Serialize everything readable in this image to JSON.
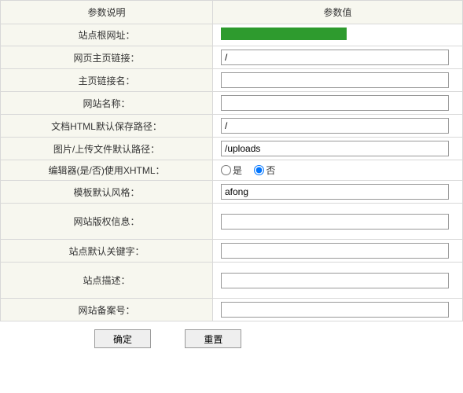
{
  "headers": {
    "param_desc": "参数说明",
    "param_value": "参数值"
  },
  "rows": {
    "root_url": {
      "label": "站点根网址：",
      "value": ""
    },
    "home_link": {
      "label": "网页主页链接：",
      "value": "/"
    },
    "home_link_name": {
      "label": "主页链接名：",
      "value": ""
    },
    "site_name": {
      "label": "网站名称：",
      "value": ""
    },
    "html_path": {
      "label": "文档HTML默认保存路径：",
      "value": "/"
    },
    "upload_path": {
      "label": "图片/上传文件默认路径：",
      "value": "/uploads"
    },
    "editor_xhtml": {
      "label": "编辑器(是/否)使用XHTML：",
      "yes": "是",
      "no": "否",
      "selected": "no"
    },
    "template_style": {
      "label": "模板默认风格：",
      "value": "afong"
    },
    "copyright": {
      "label": "网站版权信息：",
      "value": ""
    },
    "keywords": {
      "label": "站点默认关键字：",
      "value": ""
    },
    "description": {
      "label": "站点描述：",
      "value": ""
    },
    "beian": {
      "label": "网站备案号：",
      "value": ""
    }
  },
  "buttons": {
    "submit": "确定",
    "reset": "重置"
  }
}
